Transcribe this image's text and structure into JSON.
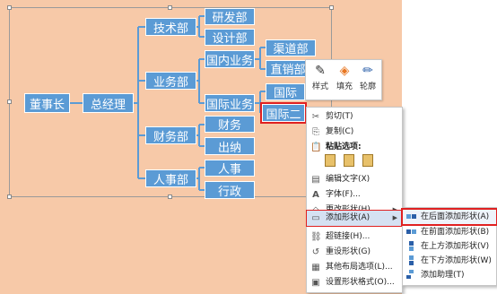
{
  "org_chart": {
    "root": "董事长",
    "gm": "总经理",
    "depts": {
      "tech": "技术部",
      "business": "业务部",
      "finance": "财务部",
      "hr": "人事部"
    },
    "subs": {
      "rd": "研发部",
      "design": "设计部",
      "domestic": "国内业务",
      "channel": "渠道部",
      "direct": "直销部",
      "intl": "国际业务",
      "intl_one": "国际",
      "intl_two": "国际二",
      "finance_sub": "财务",
      "cashier": "出纳",
      "personnel": "人事",
      "admin": "行政"
    }
  },
  "mini_toolbar": {
    "style": "样式",
    "fill": "填充",
    "outline": "轮廓"
  },
  "context_menu": {
    "cut": "剪切(T)",
    "copy": "复制(C)",
    "paste_options": "粘贴选项:",
    "edit_text": "编辑文字(X)",
    "font": "字体(F)...",
    "change_shape": "更改形状(H)",
    "add_shape": "添加形状(A)",
    "hyperlink": "超链接(H)...",
    "reset_shape": "重设形状(G)",
    "other_layout": "其他布局选项(L)...",
    "format_shape": "设置形状格式(O)..."
  },
  "submenu": {
    "add_after": "在后面添加形状(A)",
    "add_before": "在前面添加形状(B)",
    "add_above": "在上方添加形状(V)",
    "add_below": "在下方添加形状(W)",
    "add_assistant": "添加助理(T)"
  },
  "colors": {
    "node": "#5b9bd5",
    "canvas": "#f7c9a8",
    "highlight": "#e02020"
  }
}
